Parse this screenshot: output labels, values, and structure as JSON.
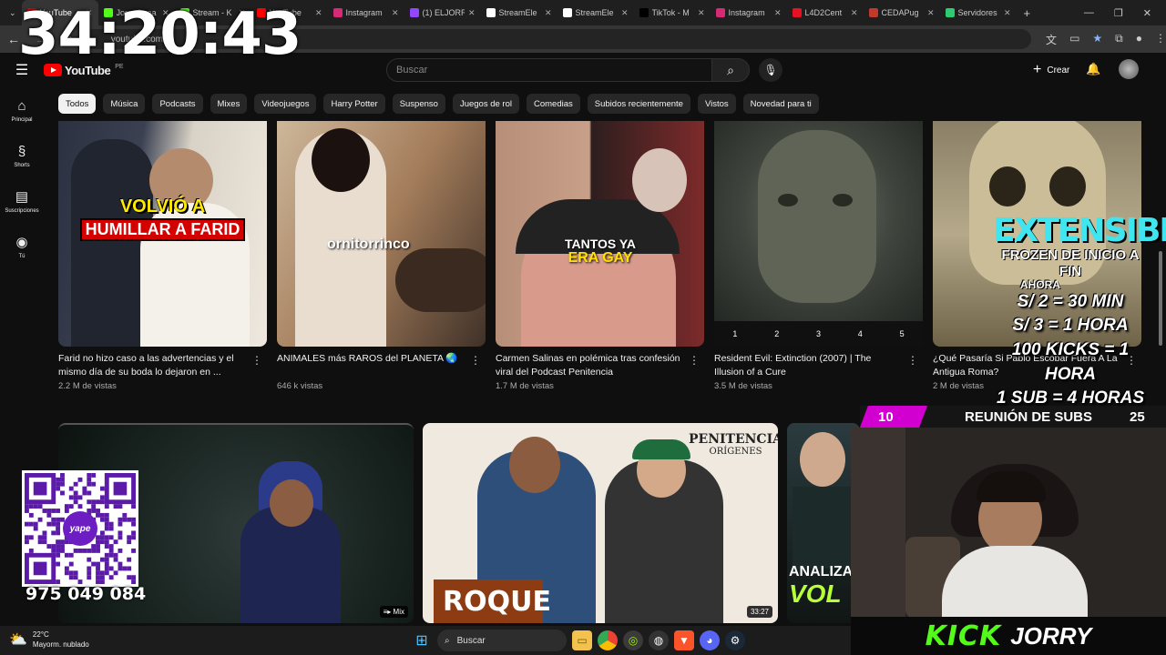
{
  "timer": "34:20:43",
  "tabs": [
    {
      "title": "YouTube",
      "color": "#ff0000",
      "active": true
    },
    {
      "title": "Jorry Strea",
      "color": "#53fc18"
    },
    {
      "title": "Stream - K",
      "color": "#53fc18"
    },
    {
      "title": "YouTube",
      "color": "#ff0000"
    },
    {
      "title": "Instagram",
      "color": "#d62976"
    },
    {
      "title": "(1) ELJORR",
      "color": "#9146ff"
    },
    {
      "title": "StreamEle",
      "color": "#ffffff"
    },
    {
      "title": "StreamEle",
      "color": "#ffffff"
    },
    {
      "title": "TikTok - M",
      "color": "#000000"
    },
    {
      "title": "Instagram",
      "color": "#d62976"
    },
    {
      "title": "L4D2Cent",
      "color": "#e81123"
    },
    {
      "title": "CEDAPug",
      "color": "#c0392b"
    },
    {
      "title": "Servidores",
      "color": "#2ecc71"
    }
  ],
  "address": {
    "url": "youtube.com"
  },
  "header": {
    "logo": "YouTube",
    "region": "PE",
    "search_placeholder": "Buscar",
    "create_label": "Crear"
  },
  "sidebar": [
    {
      "label": "Principal",
      "icon": "home-icon",
      "glyph": "⌂"
    },
    {
      "label": "Shorts",
      "icon": "shorts-icon",
      "glyph": "§"
    },
    {
      "label": "Suscripciones",
      "icon": "subscriptions-icon",
      "glyph": "▤"
    },
    {
      "label": "Tú",
      "icon": "you-icon",
      "glyph": "◉"
    }
  ],
  "chips": [
    "Todos",
    "Música",
    "Podcasts",
    "Mixes",
    "Videojuegos",
    "Harry Potter",
    "Suspenso",
    "Juegos de rol",
    "Comedias",
    "Subidos recientemente",
    "Vistos",
    "Novedad para ti"
  ],
  "videos": [
    {
      "title": "Farid no hizo caso a las advertencias y el mismo día de su boda lo dejaron en ...",
      "meta": "2.2 M de vistas",
      "overlay1": "VOLVIÓ A",
      "overlay2": "HUMILLAR A FARID"
    },
    {
      "title": "ANIMALES más RAROS del PLANETA 🌏",
      "meta": "646 k vistas",
      "overlay1": "ornitorrinco"
    },
    {
      "title": "Carmen Salinas en polémica tras confesión viral del Podcast Penitencia",
      "meta": "1.7 M de vistas",
      "overlay1": "TANTOS YA",
      "overlay2": "ERA GAY"
    },
    {
      "title": "Resident Evil: Extinction (2007) | The Illusion of a Cure",
      "meta": "3.5 M de vistas",
      "chapters": [
        "1",
        "2",
        "3",
        "4",
        "5"
      ]
    },
    {
      "title": "¿Qué Pasaría Si Pablo Escobar Fuera A La Antigua Roma?",
      "meta": "2 M de vistas"
    }
  ],
  "row2": [
    {
      "badge": "Mix"
    },
    {
      "badge": "33:27",
      "overlay": "ROQUE",
      "brand": "PENITENCIA",
      "brand_sub": "ORÍGENES"
    },
    {
      "overlay": "ANALIZA",
      "overlay2": "VOL"
    }
  ],
  "stream": {
    "qr_number": "975 049 084",
    "qr_brand": "yape",
    "subs_current": "10",
    "subs_label": "REUNIÓN DE SUBS",
    "subs_goal": "25",
    "promo_title": "EXTENSIBLE",
    "promo_sub": "FROZEN DE INICIO A FIN",
    "promo_now": "AHORA",
    "prices": [
      "S/ 2 = 30 MIN",
      "S/ 3  = 1 HORA",
      "100 KICKS = 1 HORA",
      "1 SUB = 4 HORAS"
    ],
    "kick": "KICK",
    "channel": "JORRY"
  },
  "taskbar": {
    "temp": "22°C",
    "weather": "Mayorm. nublado",
    "search": "Buscar"
  }
}
